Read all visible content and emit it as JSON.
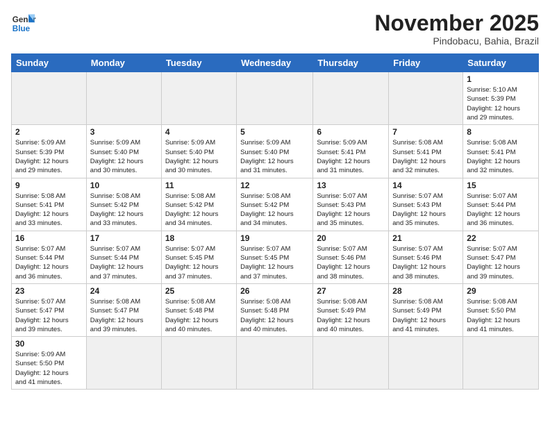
{
  "logo": {
    "line1": "General",
    "line2": "Blue"
  },
  "title": "November 2025",
  "subtitle": "Pindobacu, Bahia, Brazil",
  "weekdays": [
    "Sunday",
    "Monday",
    "Tuesday",
    "Wednesday",
    "Thursday",
    "Friday",
    "Saturday"
  ],
  "weeks": [
    [
      {
        "day": "",
        "info": ""
      },
      {
        "day": "",
        "info": ""
      },
      {
        "day": "",
        "info": ""
      },
      {
        "day": "",
        "info": ""
      },
      {
        "day": "",
        "info": ""
      },
      {
        "day": "",
        "info": ""
      },
      {
        "day": "1",
        "info": "Sunrise: 5:10 AM\nSunset: 5:39 PM\nDaylight: 12 hours\nand 29 minutes."
      }
    ],
    [
      {
        "day": "2",
        "info": "Sunrise: 5:09 AM\nSunset: 5:39 PM\nDaylight: 12 hours\nand 29 minutes."
      },
      {
        "day": "3",
        "info": "Sunrise: 5:09 AM\nSunset: 5:40 PM\nDaylight: 12 hours\nand 30 minutes."
      },
      {
        "day": "4",
        "info": "Sunrise: 5:09 AM\nSunset: 5:40 PM\nDaylight: 12 hours\nand 30 minutes."
      },
      {
        "day": "5",
        "info": "Sunrise: 5:09 AM\nSunset: 5:40 PM\nDaylight: 12 hours\nand 31 minutes."
      },
      {
        "day": "6",
        "info": "Sunrise: 5:09 AM\nSunset: 5:41 PM\nDaylight: 12 hours\nand 31 minutes."
      },
      {
        "day": "7",
        "info": "Sunrise: 5:08 AM\nSunset: 5:41 PM\nDaylight: 12 hours\nand 32 minutes."
      },
      {
        "day": "8",
        "info": "Sunrise: 5:08 AM\nSunset: 5:41 PM\nDaylight: 12 hours\nand 32 minutes."
      }
    ],
    [
      {
        "day": "9",
        "info": "Sunrise: 5:08 AM\nSunset: 5:41 PM\nDaylight: 12 hours\nand 33 minutes."
      },
      {
        "day": "10",
        "info": "Sunrise: 5:08 AM\nSunset: 5:42 PM\nDaylight: 12 hours\nand 33 minutes."
      },
      {
        "day": "11",
        "info": "Sunrise: 5:08 AM\nSunset: 5:42 PM\nDaylight: 12 hours\nand 34 minutes."
      },
      {
        "day": "12",
        "info": "Sunrise: 5:08 AM\nSunset: 5:42 PM\nDaylight: 12 hours\nand 34 minutes."
      },
      {
        "day": "13",
        "info": "Sunrise: 5:07 AM\nSunset: 5:43 PM\nDaylight: 12 hours\nand 35 minutes."
      },
      {
        "day": "14",
        "info": "Sunrise: 5:07 AM\nSunset: 5:43 PM\nDaylight: 12 hours\nand 35 minutes."
      },
      {
        "day": "15",
        "info": "Sunrise: 5:07 AM\nSunset: 5:44 PM\nDaylight: 12 hours\nand 36 minutes."
      }
    ],
    [
      {
        "day": "16",
        "info": "Sunrise: 5:07 AM\nSunset: 5:44 PM\nDaylight: 12 hours\nand 36 minutes."
      },
      {
        "day": "17",
        "info": "Sunrise: 5:07 AM\nSunset: 5:44 PM\nDaylight: 12 hours\nand 37 minutes."
      },
      {
        "day": "18",
        "info": "Sunrise: 5:07 AM\nSunset: 5:45 PM\nDaylight: 12 hours\nand 37 minutes."
      },
      {
        "day": "19",
        "info": "Sunrise: 5:07 AM\nSunset: 5:45 PM\nDaylight: 12 hours\nand 37 minutes."
      },
      {
        "day": "20",
        "info": "Sunrise: 5:07 AM\nSunset: 5:46 PM\nDaylight: 12 hours\nand 38 minutes."
      },
      {
        "day": "21",
        "info": "Sunrise: 5:07 AM\nSunset: 5:46 PM\nDaylight: 12 hours\nand 38 minutes."
      },
      {
        "day": "22",
        "info": "Sunrise: 5:07 AM\nSunset: 5:47 PM\nDaylight: 12 hours\nand 39 minutes."
      }
    ],
    [
      {
        "day": "23",
        "info": "Sunrise: 5:07 AM\nSunset: 5:47 PM\nDaylight: 12 hours\nand 39 minutes."
      },
      {
        "day": "24",
        "info": "Sunrise: 5:08 AM\nSunset: 5:47 PM\nDaylight: 12 hours\nand 39 minutes."
      },
      {
        "day": "25",
        "info": "Sunrise: 5:08 AM\nSunset: 5:48 PM\nDaylight: 12 hours\nand 40 minutes."
      },
      {
        "day": "26",
        "info": "Sunrise: 5:08 AM\nSunset: 5:48 PM\nDaylight: 12 hours\nand 40 minutes."
      },
      {
        "day": "27",
        "info": "Sunrise: 5:08 AM\nSunset: 5:49 PM\nDaylight: 12 hours\nand 40 minutes."
      },
      {
        "day": "28",
        "info": "Sunrise: 5:08 AM\nSunset: 5:49 PM\nDaylight: 12 hours\nand 41 minutes."
      },
      {
        "day": "29",
        "info": "Sunrise: 5:08 AM\nSunset: 5:50 PM\nDaylight: 12 hours\nand 41 minutes."
      }
    ],
    [
      {
        "day": "30",
        "info": "Sunrise: 5:09 AM\nSunset: 5:50 PM\nDaylight: 12 hours\nand 41 minutes."
      },
      {
        "day": "",
        "info": ""
      },
      {
        "day": "",
        "info": ""
      },
      {
        "day": "",
        "info": ""
      },
      {
        "day": "",
        "info": ""
      },
      {
        "day": "",
        "info": ""
      },
      {
        "day": "",
        "info": ""
      }
    ]
  ]
}
